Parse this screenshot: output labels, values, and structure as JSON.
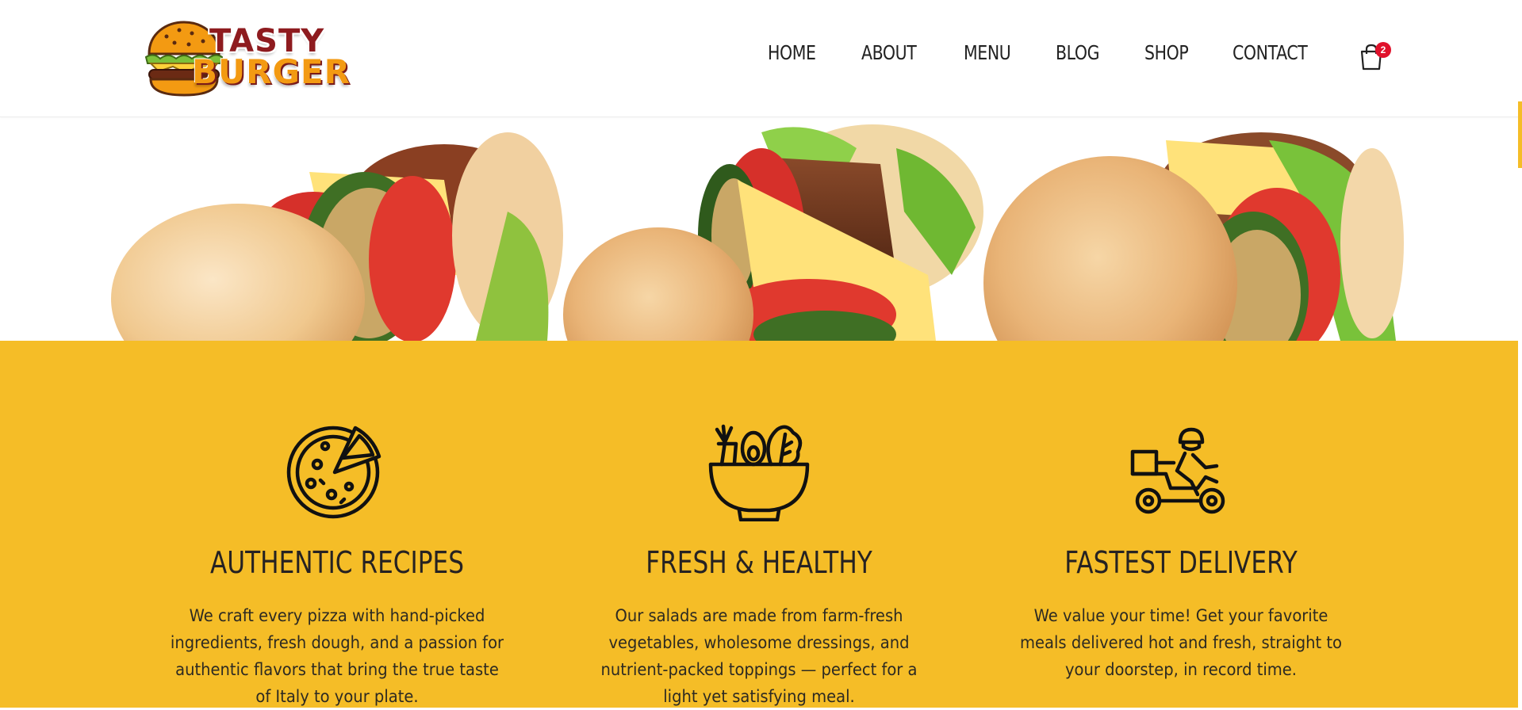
{
  "brand": {
    "logo_line1": "TASTY",
    "logo_line2": "BURGER",
    "primary_color": "#f5bd27",
    "logo_red": "#8e1b1f",
    "logo_orange": "#f39a12"
  },
  "nav": {
    "items": [
      "HOME",
      "ABOUT",
      "MENU",
      "BLOG",
      "SHOP",
      "CONTACT"
    ],
    "cart_count": "2",
    "cart_icon": "shopping-bag-icon"
  },
  "features": [
    {
      "icon": "pizza-icon",
      "title": "AUTHENTIC RECIPES",
      "description": "We craft every pizza with hand-picked ingredients, fresh dough, and a passion for authentic flavors that bring the true taste of Italy to your plate."
    },
    {
      "icon": "salad-bowl-icon",
      "title": "FRESH & HEALTHY",
      "description": "Our salads are made from farm-fresh vegetables, wholesome dressings, and nutrient-packed toppings — perfect for a light yet satisfying meal."
    },
    {
      "icon": "delivery-scooter-icon",
      "title": "FASTEST DELIVERY",
      "description": "We value your time! Get your favorite meals delivered hot and fresh, straight to your doorstep, in record time."
    }
  ]
}
